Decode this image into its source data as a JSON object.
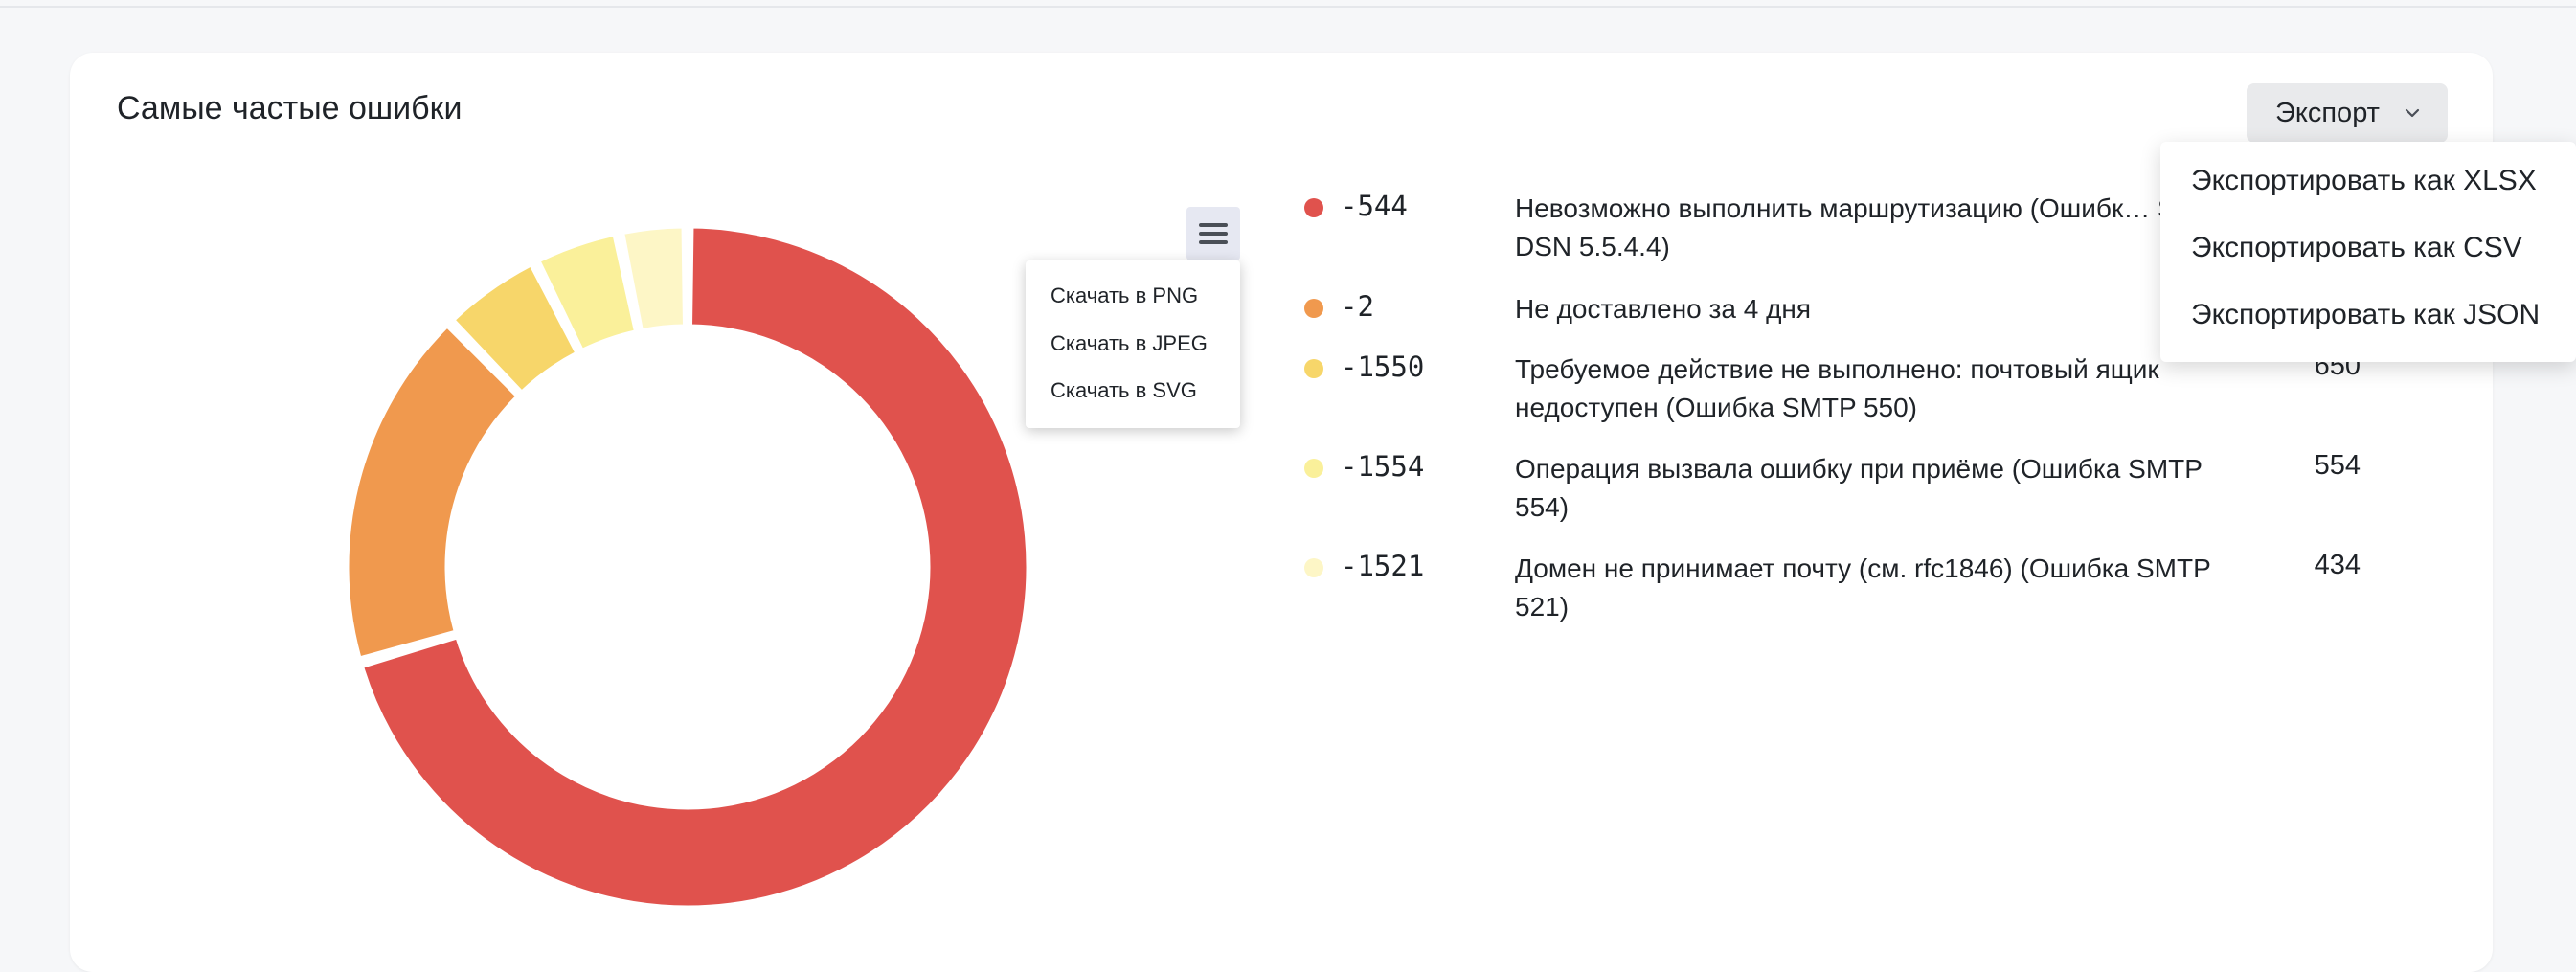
{
  "card": {
    "title": "Самые частые ошибки"
  },
  "export": {
    "label": "Экспорт",
    "menu": [
      "Экспортировать как XLSX",
      "Экспортировать как CSV",
      "Экспортировать как JSON"
    ]
  },
  "chart_menu": [
    "Скачать в PNG",
    "Скачать в JPEG",
    "Скачать в SVG"
  ],
  "colors": {
    "red": "#e0524d",
    "orange": "#f0994e",
    "yellow": "#f7d66a",
    "light_yellow": "#faf09a",
    "pale_yellow": "#fdf6c6"
  },
  "chart_data": {
    "type": "pie",
    "donut": true,
    "labels": [
      "-544",
      "-2",
      "-1550",
      "-1554",
      "-1521"
    ],
    "values": [
      9400,
      2300,
      650,
      554,
      434
    ]
  },
  "legend": [
    {
      "code": "-544",
      "desc": "Невозможно выполнить маршрутизацию (Ошибк… SMTP-DSN 5.5.4.4)",
      "count": "",
      "color": "#e0524d"
    },
    {
      "code": "-2",
      "desc": "Не доставлено за 4 дня",
      "count": "",
      "color": "#f0994e"
    },
    {
      "code": "-1550",
      "desc": "Требуемое действие не выполнено: почтовый ящик недоступен (Ошибка SMTP 550)",
      "count": "650",
      "color": "#f7d66a"
    },
    {
      "code": "-1554",
      "desc": "Операция вызвала ошибку при приёме (Ошибка SMTP 554)",
      "count": "554",
      "color": "#faf09a"
    },
    {
      "code": "-1521",
      "desc": "Домен не принимает почту (см. rfc1846) (Ошибка SMTP 521)",
      "count": "434",
      "color": "#fdf6c6"
    }
  ]
}
